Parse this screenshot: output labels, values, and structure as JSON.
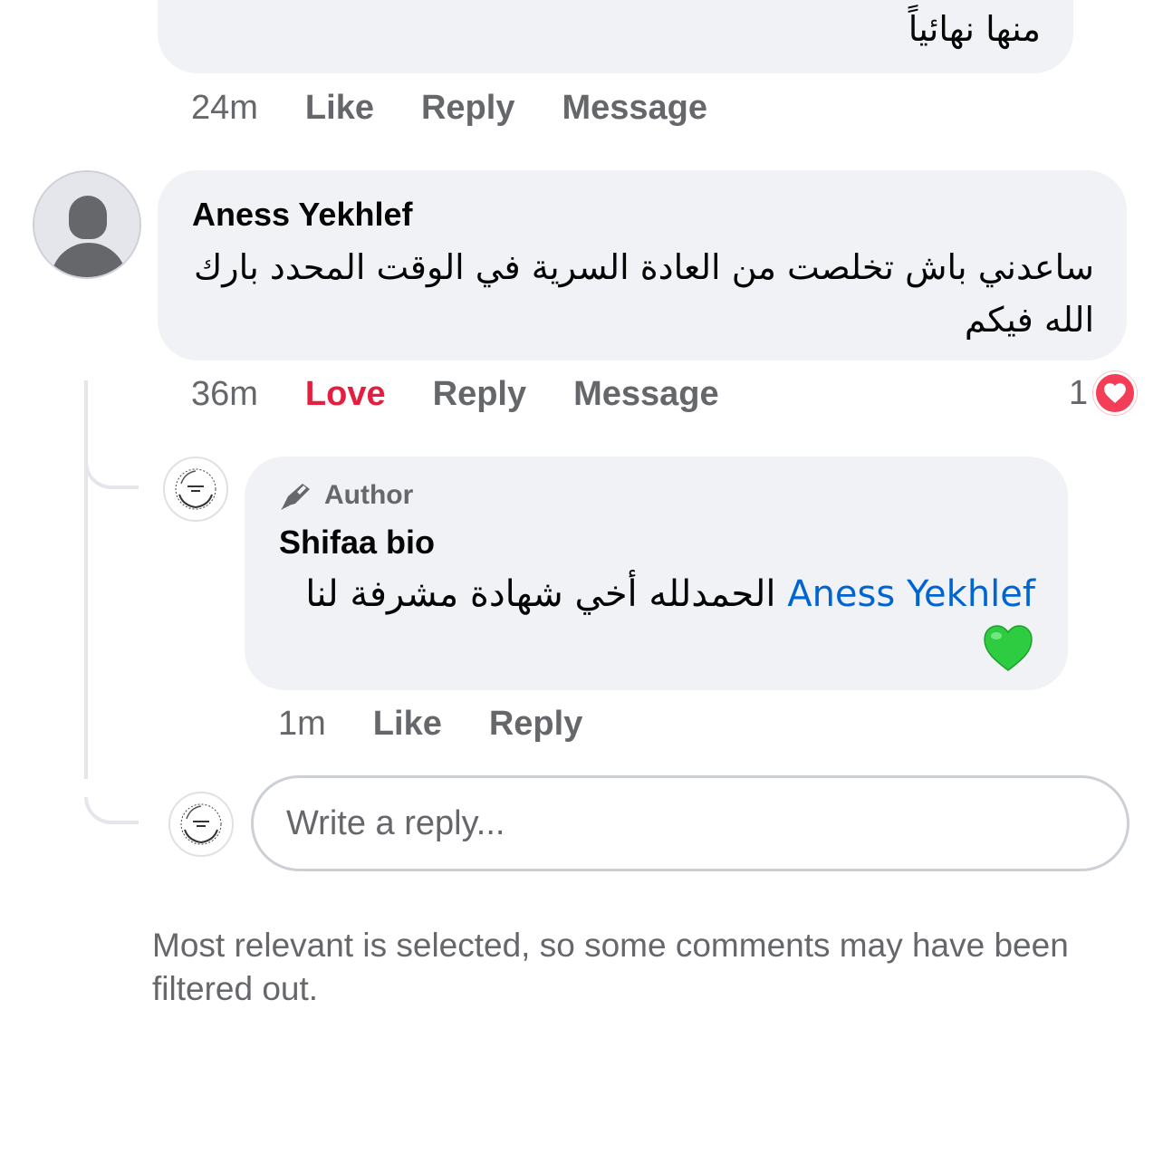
{
  "previous_comment": {
    "text_tail": "منها نهائياً",
    "time": "24m",
    "actions": {
      "like": "Like",
      "reply": "Reply",
      "message": "Message"
    }
  },
  "comment": {
    "author": "Aness Yekhlef",
    "text": "ساعدني باش تخلصت من العادة السرية في الوقت المحدد بارك الله فيكم",
    "time": "36m",
    "actions": {
      "love": "Love",
      "reply": "Reply",
      "message": "Message"
    },
    "reaction_count": "1",
    "reaction_icon": "heart-icon",
    "love_color": "#e41e3f"
  },
  "reply": {
    "badge": "Author",
    "badge_icon": "pen-icon",
    "author": "Shifaa bio",
    "mention": "Aness Yekhlef",
    "text": "الحمدلله أخي شهادة مشرفة لنا",
    "emoji": "green-heart-emoji",
    "time": "1m",
    "actions": {
      "like": "Like",
      "reply": "Reply"
    },
    "mention_color": "#0064d1"
  },
  "composer": {
    "placeholder": "Write a reply..."
  },
  "footer": {
    "note": "Most relevant is selected, so some comments may have been filtered out."
  }
}
